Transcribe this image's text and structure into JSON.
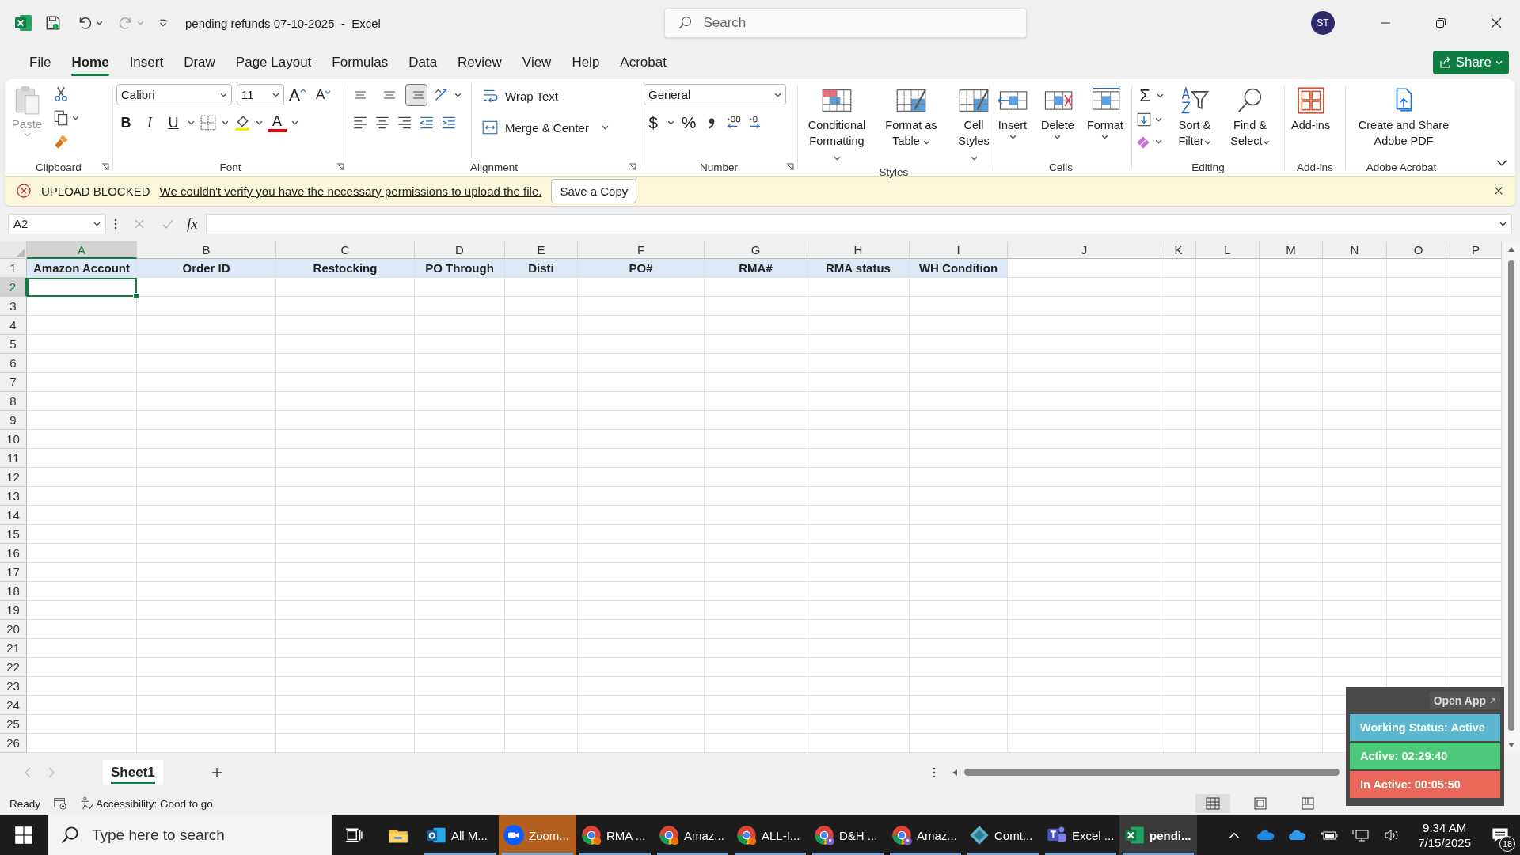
{
  "window": {
    "title": "pending refunds 07-10-2025  -  Excel",
    "search_placeholder": "Search",
    "avatar": "ST"
  },
  "menu_tabs": [
    {
      "label": "File",
      "selected": false
    },
    {
      "label": "Home",
      "selected": true
    },
    {
      "label": "Insert",
      "selected": false
    },
    {
      "label": "Draw",
      "selected": false
    },
    {
      "label": "Page Layout",
      "selected": false
    },
    {
      "label": "Formulas",
      "selected": false
    },
    {
      "label": "Data",
      "selected": false
    },
    {
      "label": "Review",
      "selected": false
    },
    {
      "label": "View",
      "selected": false
    },
    {
      "label": "Help",
      "selected": false
    },
    {
      "label": "Acrobat",
      "selected": false
    }
  ],
  "share_button": "Share",
  "ribbon": {
    "clipboard": {
      "label": "Clipboard",
      "paste": {
        "label": "Paste",
        "disabled": true
      }
    },
    "font": {
      "label": "Font",
      "name": "Calibri",
      "size": "11",
      "grow": "A",
      "shrink": "A",
      "styles": [
        "B",
        "I",
        "U"
      ],
      "font_color": "A"
    },
    "alignment": {
      "label": "Alignment",
      "vertical": [
        {
          "selected": false
        },
        {
          "selected": false
        },
        {
          "selected": true
        }
      ],
      "wrap_text": "Wrap Text",
      "merge": "Merge & Center"
    },
    "number": {
      "label": "Number",
      "format": "General",
      "currency": "$",
      "percent": "%"
    },
    "styles": {
      "label": "Styles",
      "buttons": [
        "Conditional Formatting",
        "Format as Table",
        "Cell Styles"
      ]
    },
    "cells": {
      "label": "Cells",
      "buttons": [
        "Insert",
        "Delete",
        "Format"
      ]
    },
    "editing": {
      "label": "Editing",
      "sum": "Σ",
      "buttons": [
        "Sort & Filter",
        "Find & Select"
      ]
    },
    "addins": {
      "label": "Add-ins",
      "button": "Add-ins"
    },
    "acrobat": {
      "label": "Adobe Acrobat",
      "button": "Create and Share Adobe PDF"
    }
  },
  "message_bar": {
    "title": "UPLOAD BLOCKED",
    "message": "We couldn't verify you have the necessary permissions to upload the file.",
    "button": "Save a Copy"
  },
  "formula_bar": {
    "name_box": "A2",
    "function_label": "fx"
  },
  "columns": [
    {
      "label": "A",
      "selected": true
    },
    {
      "label": "B",
      "selected": false
    },
    {
      "label": "C",
      "selected": false
    },
    {
      "label": "D",
      "selected": false
    },
    {
      "label": "E",
      "selected": false
    },
    {
      "label": "F",
      "selected": false
    },
    {
      "label": "G",
      "selected": false
    },
    {
      "label": "H",
      "selected": false
    },
    {
      "label": "I",
      "selected": false
    },
    {
      "label": "J",
      "selected": false
    },
    {
      "label": "K",
      "selected": false
    },
    {
      "label": "L",
      "selected": false
    },
    {
      "label": "M",
      "selected": false
    },
    {
      "label": "N",
      "selected": false
    },
    {
      "label": "O",
      "selected": false
    },
    {
      "label": "P",
      "selected": false
    }
  ],
  "rows": [
    {
      "number": "1",
      "selected": false,
      "cells": [
        {
          "text": "Amazon Account",
          "highlighted": true
        },
        {
          "text": "Order ID",
          "highlighted": true
        },
        {
          "text": "Restocking",
          "highlighted": true
        },
        {
          "text": "PO Through",
          "highlighted": true
        },
        {
          "text": "Disti",
          "highlighted": true
        },
        {
          "text": "PO#",
          "highlighted": true
        },
        {
          "text": "RMA#",
          "highlighted": true
        },
        {
          "text": "RMA status",
          "highlighted": true
        },
        {
          "text": "WH Condition",
          "highlighted": true
        }
      ]
    },
    {
      "number": "2",
      "selected": true
    },
    {
      "number": "3",
      "selected": false
    },
    {
      "number": "4",
      "selected": false
    },
    {
      "number": "5",
      "selected": false
    },
    {
      "number": "6",
      "selected": false
    },
    {
      "number": "7",
      "selected": false
    },
    {
      "number": "8",
      "selected": false
    },
    {
      "number": "9",
      "selected": false
    },
    {
      "number": "10",
      "selected": false
    },
    {
      "number": "11",
      "selected": false
    },
    {
      "number": "12",
      "selected": false
    },
    {
      "number": "13",
      "selected": false
    },
    {
      "number": "14",
      "selected": false
    },
    {
      "number": "15",
      "selected": false
    },
    {
      "number": "16",
      "selected": false
    },
    {
      "number": "17",
      "selected": false
    },
    {
      "number": "18",
      "selected": false
    },
    {
      "number": "19",
      "selected": false
    },
    {
      "number": "20",
      "selected": false
    },
    {
      "number": "21",
      "selected": false
    },
    {
      "number": "22",
      "selected": false
    },
    {
      "number": "23",
      "selected": false
    },
    {
      "number": "24",
      "selected": false
    },
    {
      "number": "25",
      "selected": false
    },
    {
      "number": "26",
      "selected": false
    }
  ],
  "sheet_tabs": [
    {
      "label": "Sheet1",
      "selected": true
    }
  ],
  "status_bar": {
    "ready": "Ready",
    "accessibility": "Accessibility: Good to go"
  },
  "tracker": {
    "open_app": "Open App",
    "rows": [
      {
        "text": "Working Status: Active",
        "color": "#5bb7d0"
      },
      {
        "text": "Active: 02:29:40",
        "color": "#4ec97c"
      },
      {
        "text": "In Active: 00:05:50",
        "color": "#e9685a"
      }
    ]
  },
  "taskbar": {
    "search_placeholder": "Type here to search",
    "apps": [
      {
        "kind": "explorer",
        "running": false,
        "selected": false,
        "attention": false
      },
      {
        "kind": "outlook",
        "label": "All M...",
        "running": true,
        "selected": false,
        "attention": false
      },
      {
        "kind": "zoom",
        "label": "Zoom...",
        "running": true,
        "selected": false,
        "attention": true
      },
      {
        "kind": "chrome",
        "label": "RMA ...",
        "running": true,
        "selected": false,
        "attention": false
      },
      {
        "kind": "chrome",
        "label": "Amaz...",
        "running": true,
        "selected": false,
        "attention": false
      },
      {
        "kind": "chrome",
        "label": "ALL-I...",
        "running": true,
        "selected": false,
        "attention": false
      },
      {
        "kind": "chrome-profile",
        "label": "D&H ...",
        "running": true,
        "selected": false,
        "attention": false
      },
      {
        "kind": "chrome-profile",
        "label": "Amaz...",
        "running": true,
        "selected": false,
        "attention": false
      },
      {
        "kind": "comet",
        "label": "Comt...",
        "running": true,
        "selected": false,
        "attention": false
      },
      {
        "kind": "teams",
        "label": "Excel ...",
        "running": true,
        "selected": false,
        "attention": false
      },
      {
        "kind": "excel",
        "label": "pendi...",
        "running": true,
        "selected": true,
        "attention": false
      }
    ],
    "time": "9:34 AM",
    "date": "7/15/2025",
    "notifications": "18"
  }
}
